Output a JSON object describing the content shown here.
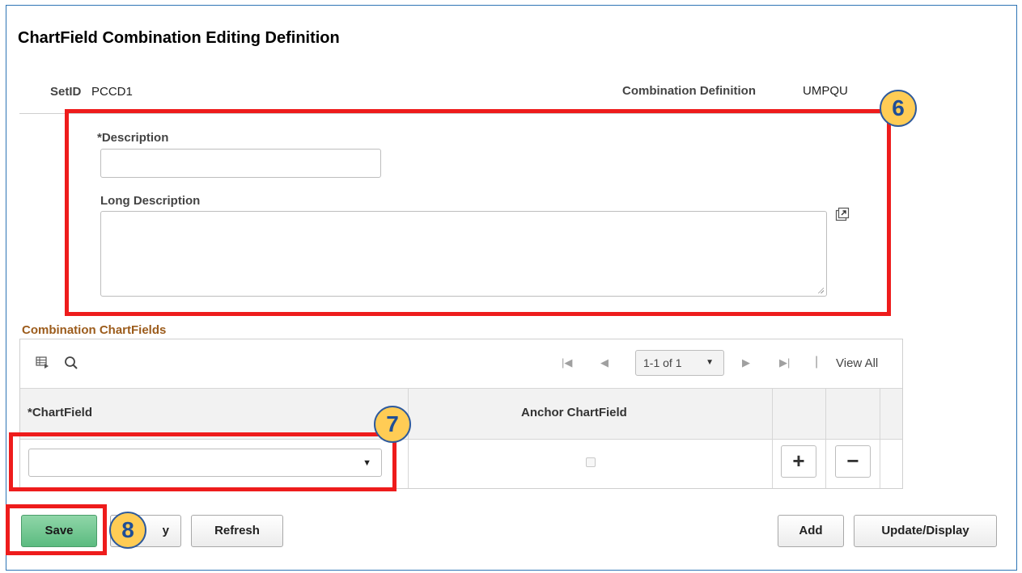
{
  "page": {
    "title": "ChartField Combination Editing Definition"
  },
  "header": {
    "setid_label": "SetID",
    "setid_value": "PCCD1",
    "combination_label": "Combination Definition",
    "combination_value": "UMPQU"
  },
  "form": {
    "description_label": "*Description",
    "description_value": "",
    "long_description_label": "Long Description",
    "long_description_value": "",
    "expand_icon": "expand-window-icon"
  },
  "grid": {
    "section_title": "Combination ChartFields",
    "toolbar": {
      "personalize_icon": "grid-personalize-icon",
      "search_icon": "search-icon",
      "first_glyph": "|◀",
      "prev_glyph": "◀",
      "pager_text": "1-1 of 1",
      "pager_caret": "▼",
      "next_glyph": "▶",
      "last_glyph": "▶|",
      "separator": "|",
      "view_all": "View All"
    },
    "columns": [
      "*ChartField",
      "Anchor ChartField"
    ],
    "rows": [
      {
        "chartfield": "",
        "anchor": false
      }
    ],
    "add_row_glyph": "+",
    "delete_row_glyph": "−",
    "select_caret": "▼"
  },
  "actions": {
    "save": "Save",
    "notify_partial": "y",
    "refresh": "Refresh",
    "add": "Add",
    "update_display": "Update/Display"
  },
  "callouts": {
    "badge_6": "6",
    "badge_7": "7",
    "badge_8": "8"
  },
  "colors": {
    "callout_red": "#ee1c1c",
    "badge_fill": "#ffcc55",
    "badge_text": "#1f4e96",
    "section_title": "#9c5c1c",
    "save_green": "#5cbb80"
  }
}
